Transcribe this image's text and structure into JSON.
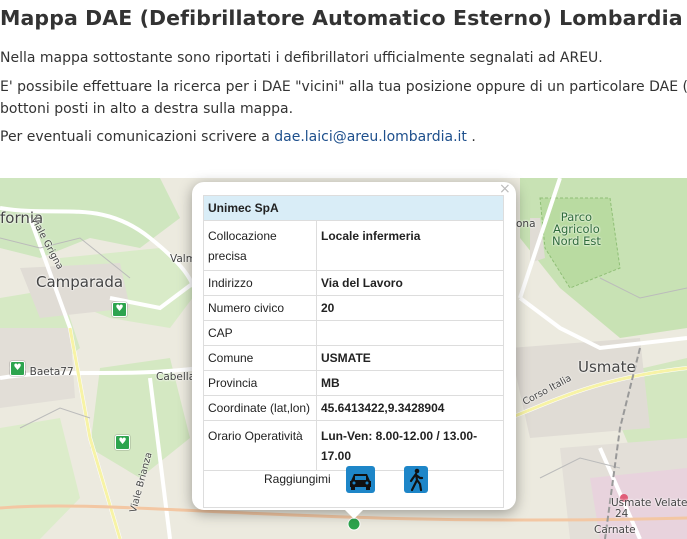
{
  "page": {
    "title": "Mappa DAE (Defibrillatore Automatico Esterno) Lombardia",
    "intro": "Nella mappa sottostante sono riportati i defibrillatori ufficialmente segnalati ad AREU.",
    "search_line1": "E' possibile effettuare la ricerca per i DAE \"vicini\" alla tua posizione oppure di un particolare DAE (",
    "search_line2": "bottoni posti in alto a destra sulla mappa.",
    "contact_prefix": "Per eventuali comunicazioni scrivere a ",
    "contact_email": "dae.laici@areu.lombardia.it",
    "contact_suffix": " ."
  },
  "map": {
    "labels": {
      "fornia": "fornia",
      "camparada": "Camparada",
      "viale_grigna": "Viale Grigna",
      "valm": "Valm",
      "via_baeta": "Via Baeta77",
      "cabella": "Cabella",
      "viale_brianza": "Viale Brianza",
      "parco": "Parco\nAgricolo\nNord Est",
      "usmate": "Usmate",
      "corso_italia": "Corso Italia",
      "usmate_velate": "Usmate Velate",
      "carnate": "Carnate",
      "ona": "ona",
      "num24": "24"
    },
    "marker_icon": "aed-heart-icon"
  },
  "popup": {
    "close": "×",
    "header": "Unimec SpA",
    "rows": [
      {
        "key": "Collocazione precisa",
        "value": "Locale infermeria"
      },
      {
        "key": "Indirizzo",
        "value": "Via del Lavoro"
      },
      {
        "key": "Numero civico",
        "value": "20"
      },
      {
        "key": "CAP",
        "value": ""
      },
      {
        "key": "Comune",
        "value": "USMATE"
      },
      {
        "key": "Provincia",
        "value": "MB"
      },
      {
        "key": "Coordinate (lat,lon)",
        "value": "45.6413422,9.3428904"
      },
      {
        "key": "Orario Operatività",
        "value": "Lun-Ven: 8.00-12.00 / 13.00-17.00"
      }
    ],
    "reach_label": "Raggiungimi",
    "car_icon": "car-icon",
    "walk_icon": "walk-icon"
  }
}
